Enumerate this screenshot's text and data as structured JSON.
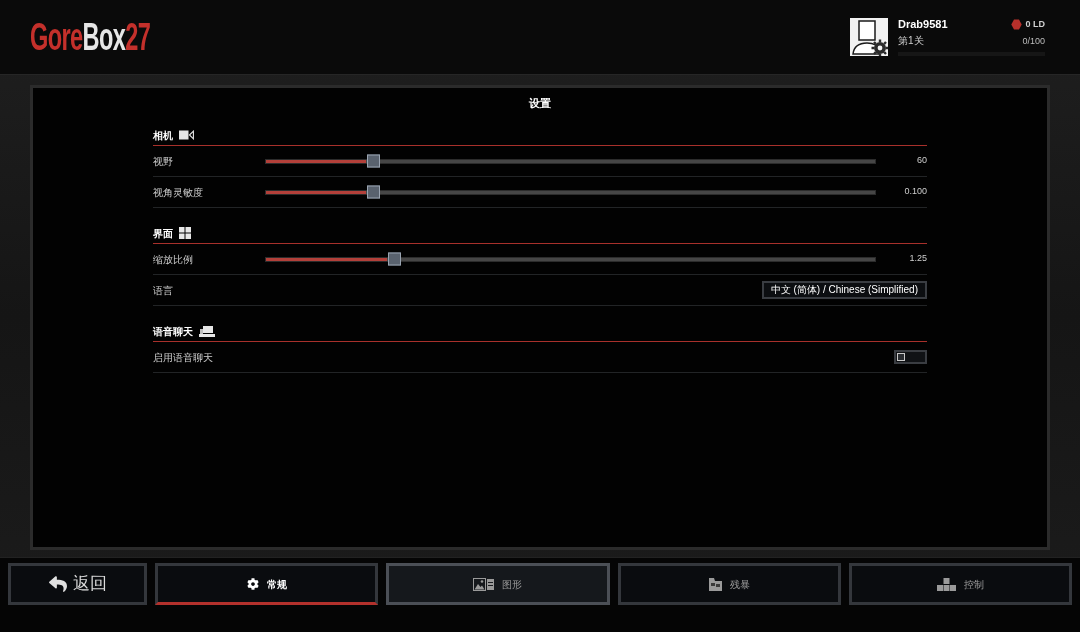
{
  "header": {
    "logo": [
      {
        "text": "Gore",
        "color": "#c4302b"
      },
      {
        "text": "Box",
        "color": "#e6e6e6"
      },
      {
        "text": "27",
        "color": "#c4302b"
      }
    ],
    "profile": {
      "name": "Drab9581",
      "rank": "第1关",
      "currency": "0 LD",
      "xp": "0/100",
      "xp_bar": {
        "level": 0
      }
    }
  },
  "settings": {
    "title": "设置",
    "sections": [
      {
        "title": "相机",
        "rows": [
          {
            "kind": "slider",
            "label": "视野",
            "level": 0.175,
            "value": "60"
          },
          {
            "kind": "slider",
            "label": "视角灵敏度",
            "level": 0.175,
            "value": "0.100"
          }
        ]
      },
      {
        "title": "界面",
        "rows": [
          {
            "kind": "slider",
            "label": "缩放比例",
            "level": 0.21,
            "value": "1.25"
          },
          {
            "kind": "dropdown",
            "label": "语言",
            "value": "中文 (简体) / Chinese (Simplified)"
          }
        ]
      },
      {
        "title": "语音聊天",
        "rows": [
          {
            "kind": "toggle",
            "label": "启用语音聊天",
            "on": false
          }
        ]
      }
    ]
  },
  "footer": {
    "back": {
      "label": "返回"
    },
    "tabs": [
      {
        "label": "常规",
        "selected": true,
        "hovered": false
      },
      {
        "label": "图形",
        "selected": false,
        "hovered": true
      },
      {
        "label": "残暴",
        "selected": false,
        "hovered": false
      },
      {
        "label": "控制",
        "selected": false,
        "hovered": false
      }
    ]
  }
}
